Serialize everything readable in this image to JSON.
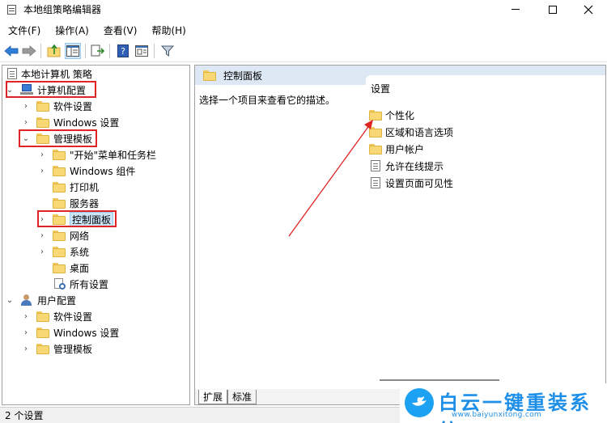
{
  "window": {
    "title": "本地组策略编辑器"
  },
  "menu": {
    "items": [
      "文件(F)",
      "操作(A)",
      "查看(V)",
      "帮助(H)"
    ]
  },
  "toolbar": {
    "buttons": [
      "back-icon",
      "forward-icon",
      "up-folder-icon",
      "show-hide-tree-icon",
      "export-list-icon",
      "help-icon",
      "properties-icon",
      "filter-icon"
    ]
  },
  "tree": {
    "root": "本地计算机 策略",
    "computer_config": "计算机配置",
    "software_settings": "软件设置",
    "windows_settings": "Windows 设置",
    "admin_templates": "管理模板",
    "start_menu": "\"开始\"菜单和任务栏",
    "windows_components": "Windows 组件",
    "printers": "打印机",
    "server": "服务器",
    "control_panel": "控制面板",
    "network": "网络",
    "system": "系统",
    "desktop": "桌面",
    "all_settings": "所有设置",
    "user_config": "用户配置",
    "user_software_settings": "软件设置",
    "user_windows_settings": "Windows 设置",
    "user_admin_templates": "管理模板"
  },
  "right_pane": {
    "header": "控制面板",
    "description": "选择一个项目来查看它的描述。",
    "column_header": "设置",
    "items": [
      {
        "label": "个性化",
        "icon": "folder-icon"
      },
      {
        "label": "区域和语言选项",
        "icon": "folder-icon"
      },
      {
        "label": "用户帐户",
        "icon": "folder-icon"
      },
      {
        "label": "允许在线提示",
        "icon": "policy-setting-icon"
      },
      {
        "label": "设置页面可见性",
        "icon": "policy-setting-icon"
      }
    ],
    "tabs": [
      "扩展",
      "标准"
    ]
  },
  "status": {
    "text": "2 个设置"
  },
  "watermark": {
    "title": "白云一键重装系统",
    "url": "www.baiyunxitong.com"
  },
  "colors": {
    "highlight_box": "#e02424",
    "header_bg": "#dde8f4",
    "selection_bg": "#cce4f7",
    "watermark_blue": "#1d8fe8"
  }
}
